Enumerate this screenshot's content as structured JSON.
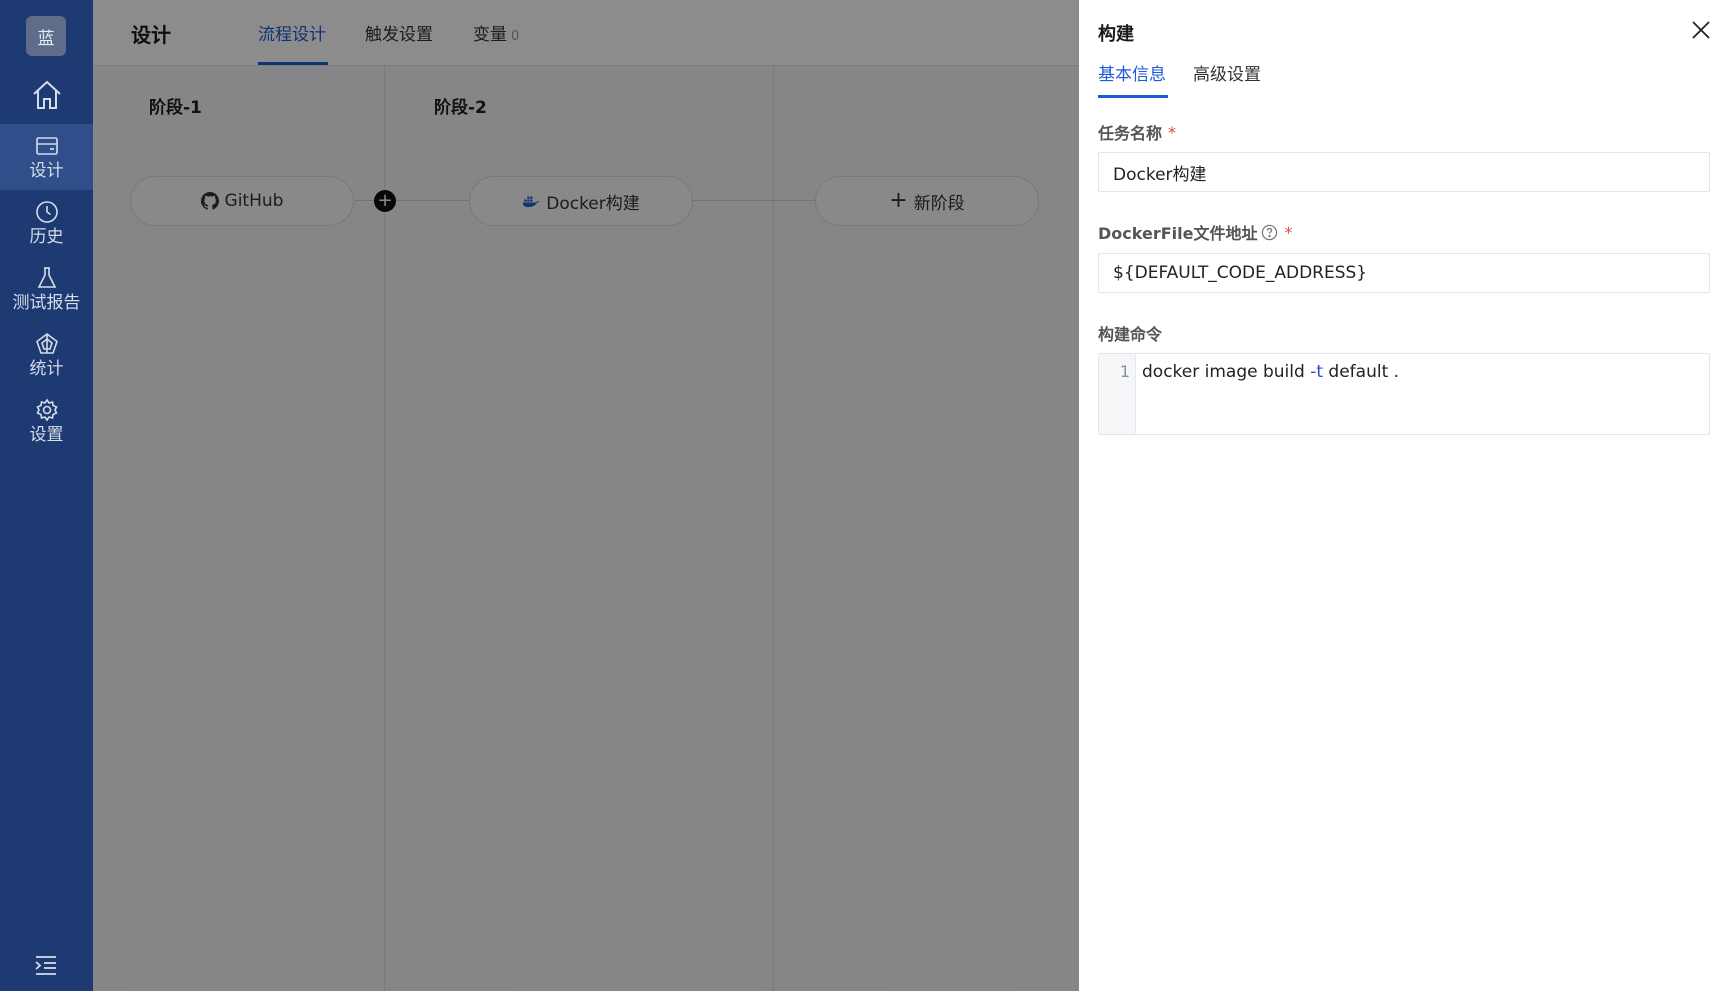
{
  "sidebar": {
    "logo": "蓝",
    "items": [
      {
        "label": "设计",
        "icon": "card-icon"
      },
      {
        "label": "历史",
        "icon": "clock-icon"
      },
      {
        "label": "测试报告",
        "icon": "flask-icon"
      },
      {
        "label": "统计",
        "icon": "pentagon-chart-icon"
      },
      {
        "label": "设置",
        "icon": "gear-icon"
      }
    ],
    "active": "设计"
  },
  "header": {
    "title": "设计",
    "tabs": [
      {
        "label": "流程设计",
        "active": true
      },
      {
        "label": "触发设置",
        "active": false
      },
      {
        "label": "变量",
        "count": "0",
        "active": false
      }
    ]
  },
  "pipeline": {
    "stages": [
      {
        "title": "阶段-1",
        "job": {
          "label": "GitHub",
          "icon": "github-icon"
        }
      },
      {
        "title": "阶段-2",
        "job": {
          "label": "Docker构建",
          "icon": "docker-icon"
        }
      }
    ],
    "new_stage_label": "新阶段"
  },
  "drawer": {
    "title": "构建",
    "tabs": [
      {
        "label": "基本信息",
        "active": true
      },
      {
        "label": "高级设置",
        "active": false
      }
    ],
    "fields": {
      "task_name": {
        "label": "任务名称",
        "value": "Docker构建",
        "required": true
      },
      "dockerfile": {
        "label": "DockerFile文件地址",
        "value": "${DEFAULT_CODE_ADDRESS}",
        "required": true
      },
      "build_command": {
        "label": "构建命令",
        "line_number": "1",
        "code_prefix": "docker image build ",
        "code_flag": "-t",
        "code_suffix": " default ."
      }
    }
  },
  "colors": {
    "sidebar_bg": "#1e3a73",
    "accent": "#1e5bd8",
    "required": "#e5484d"
  }
}
